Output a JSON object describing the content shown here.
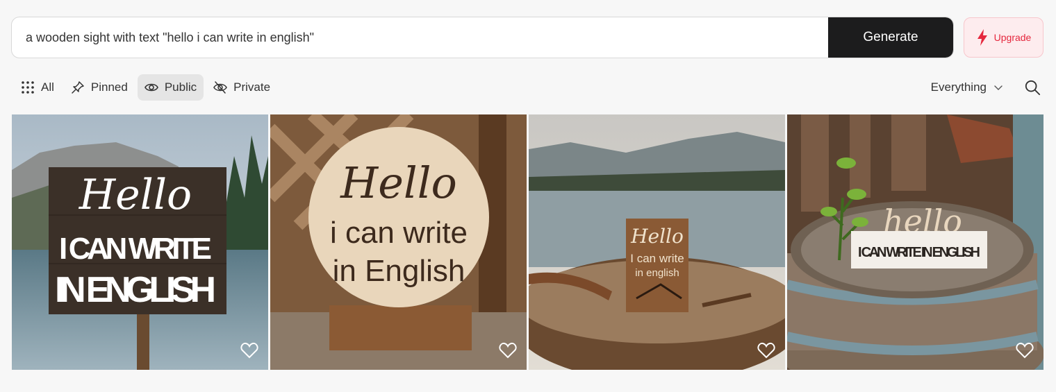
{
  "prompt": {
    "value": "a wooden sight with text \"hello i can write in english\"",
    "generate_label": "Generate"
  },
  "upgrade": {
    "label": "Upgrade",
    "icon": "lightning-icon",
    "color": "#e5273d"
  },
  "filters": [
    {
      "label": "All",
      "icon": "grid-icon",
      "active": false
    },
    {
      "label": "Pinned",
      "icon": "pin-icon",
      "active": false
    },
    {
      "label": "Public",
      "icon": "eye-icon",
      "active": true
    },
    {
      "label": "Private",
      "icon": "eye-off-icon",
      "active": false
    }
  ],
  "sort": {
    "selected": "Everything"
  },
  "gallery": [
    {
      "line1": "Hello",
      "line2": "I CAN WRITE",
      "line3": "IN ENGLISH",
      "scene": "lake sign"
    },
    {
      "line1": "Hello",
      "line2": "i can write",
      "line3": "in English",
      "scene": "round wooden plaque"
    },
    {
      "line1": "Hello",
      "line2": "I can write",
      "line3": "in english",
      "scene": "barrel by lake"
    },
    {
      "line1": "hello",
      "line2": "I CAN WRITE IN ENGLISH",
      "line3": "",
      "scene": "barrel with plant"
    }
  ],
  "colors": {
    "accent": "#1c1c1d",
    "background": "#f7f7f7"
  }
}
